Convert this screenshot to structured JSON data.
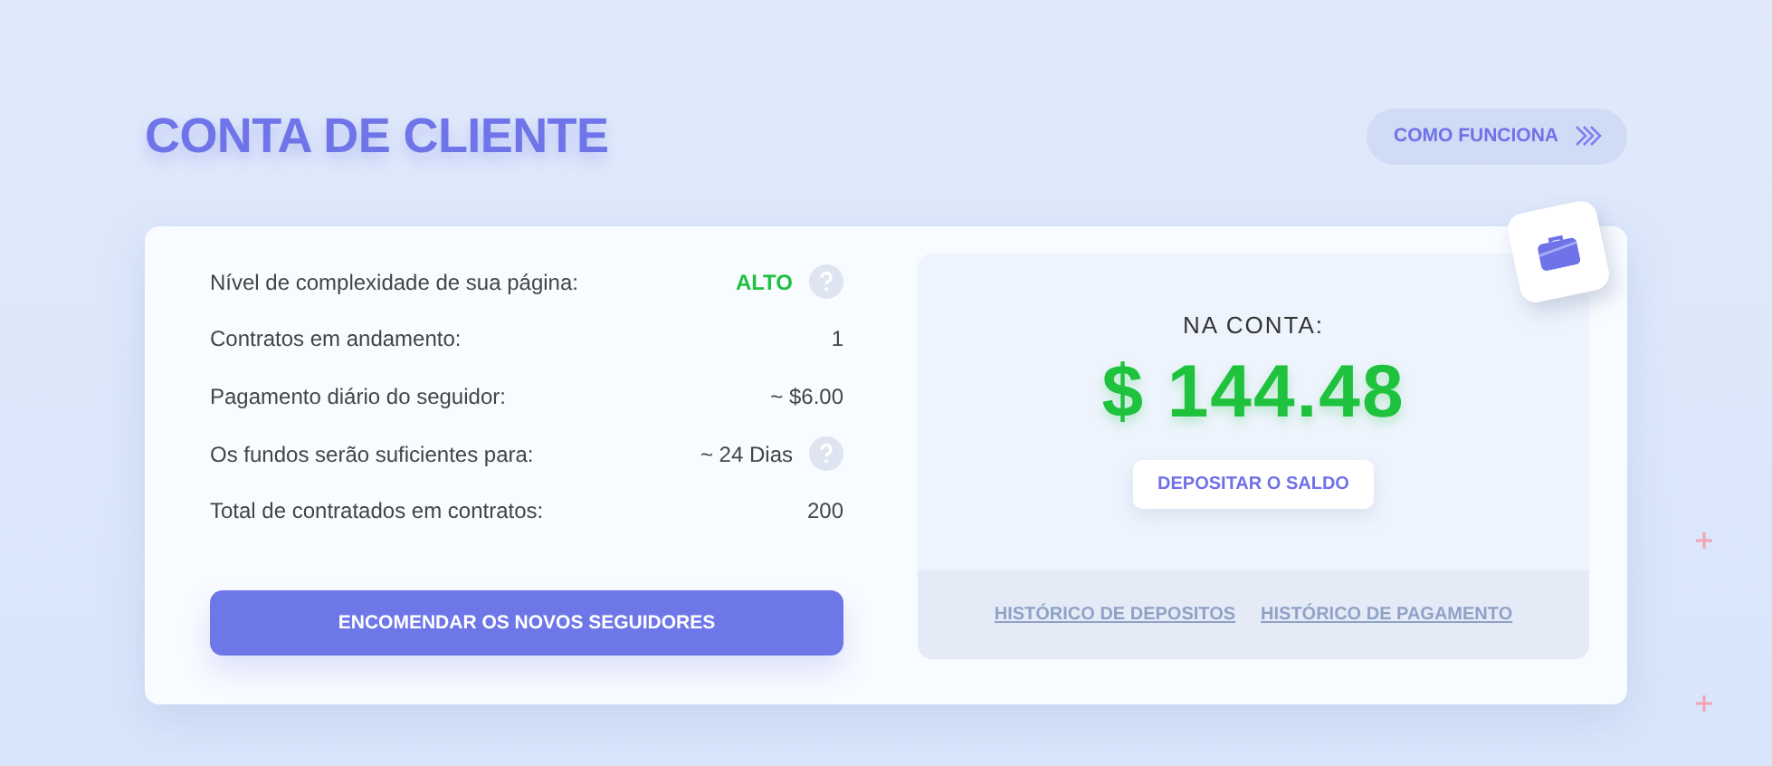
{
  "header": {
    "title": "CONTA DE CLIENTE",
    "how_it_works": "COMO FUNCIONA"
  },
  "stats": [
    {
      "label": "Nível de complexidade de sua página:",
      "value": "ALTO",
      "highlight": true,
      "help": true
    },
    {
      "label": "Contratos em andamento:",
      "value": "1",
      "highlight": false,
      "help": false
    },
    {
      "label": "Pagamento diário do seguidor:",
      "value": "~ $6.00",
      "highlight": false,
      "help": false
    },
    {
      "label": "Os fundos serão suficientes para:",
      "value": "~ 24 Dias",
      "highlight": false,
      "help": true
    },
    {
      "label": "Total de contratados em contratos:",
      "value": "200",
      "highlight": false,
      "help": false
    }
  ],
  "order_button": "ENCOMENDAR OS NOVOS SEGUIDORES",
  "account": {
    "caption": "NA CONTA:",
    "balance": "$ 144.48",
    "deposit_button": "DEPOSITAR O SALDO",
    "links": [
      "HISTÓRICO DE DEPOSITOS",
      "HISTÓRICO DE PAGAMENTO"
    ]
  }
}
